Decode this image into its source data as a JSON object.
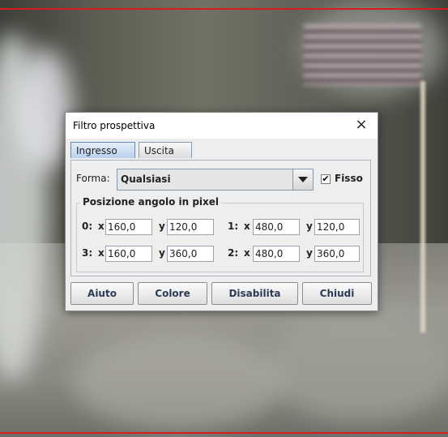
{
  "dialog": {
    "title": "Filtro prospettiva",
    "close_glyph": "×"
  },
  "tabs": [
    {
      "label": "Ingresso",
      "active": true
    },
    {
      "label": "Uscita",
      "active": false
    }
  ],
  "shape": {
    "label": "Forma:",
    "value": "Qualsiasi",
    "fixed_label": "Fisso",
    "fixed_checked": true,
    "check_glyph": "✔"
  },
  "corners": {
    "group_label": "Posizione angolo in pixel",
    "x_label": "x",
    "y_label": "y",
    "items": [
      {
        "id": "0:",
        "x": "160,0",
        "y": "120,0"
      },
      {
        "id": "1:",
        "x": "480,0",
        "y": "120,0"
      },
      {
        "id": "3:",
        "x": "160,0",
        "y": "360,0"
      },
      {
        "id": "2:",
        "x": "480,0",
        "y": "360,0"
      }
    ]
  },
  "buttons": {
    "help": "Aiuto",
    "color": "Colore",
    "disable": "Disabilita",
    "close": "Chiudi"
  },
  "colors": {
    "guide_line": "#d61c1c",
    "active_tab": "#b9d1ec",
    "button_text": "#2b3b57"
  },
  "icons": {
    "close": "close-icon",
    "dropdown": "chevron-down-icon",
    "check": "check-icon"
  }
}
